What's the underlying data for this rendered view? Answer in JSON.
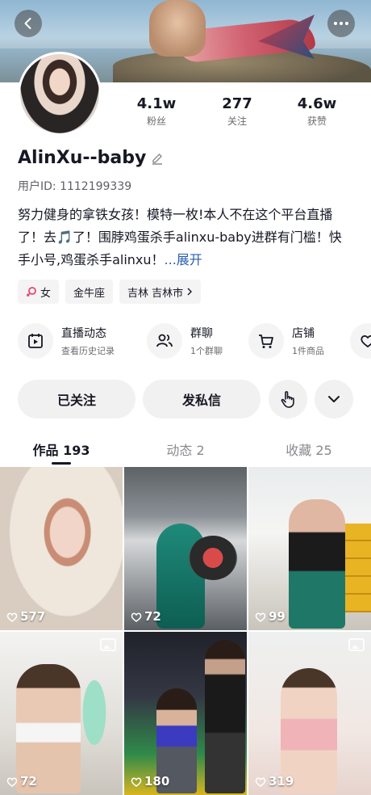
{
  "header": {
    "back_icon": "chevron-left-icon",
    "more_icon": "ellipsis-icon"
  },
  "profile": {
    "stats": [
      {
        "value": "4.1w",
        "label": "粉丝"
      },
      {
        "value": "277",
        "label": "关注"
      },
      {
        "value": "4.6w",
        "label": "获赞"
      }
    ],
    "username": "AlinXu--baby",
    "user_id": "用户ID: 1112199339",
    "bio": "努力健身的拿铁女孩！模特一枚!本人不在这个平台直播了！去🎵了！围脖鸡蛋杀手alinxu-baby进群有门槛！快手小号,鸡蛋杀手alinxu！",
    "bio_more": "...展开",
    "tags": {
      "gender": "女",
      "zodiac": "金牛座",
      "location": "吉林 吉林市"
    }
  },
  "features": [
    {
      "title": "直播动态",
      "subtitle": "查看历史记录",
      "icon": "live-calendar-icon"
    },
    {
      "title": "群聊",
      "subtitle": "1个群聊",
      "icon": "group-icon"
    },
    {
      "title": "店铺",
      "subtitle": "1件商品",
      "icon": "cart-icon"
    }
  ],
  "actions": {
    "follow": "已关注",
    "message": "发私信"
  },
  "tabs": [
    {
      "label": "作品 193",
      "active": true
    },
    {
      "label": "动态 2",
      "active": false
    },
    {
      "label": "收藏 25",
      "active": false
    }
  ],
  "posts": [
    {
      "likes": "577",
      "has_image_badge": false
    },
    {
      "likes": "72",
      "has_image_badge": false
    },
    {
      "likes": "99",
      "has_image_badge": false
    },
    {
      "likes": "72",
      "has_image_badge": true
    },
    {
      "likes": "180",
      "has_image_badge": false
    },
    {
      "likes": "319",
      "has_image_badge": true
    }
  ]
}
